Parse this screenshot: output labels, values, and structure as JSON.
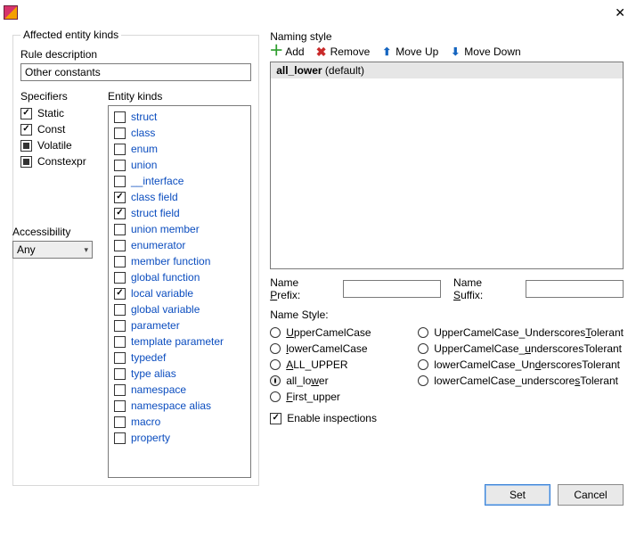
{
  "titlebar": {
    "close_aria": "Close"
  },
  "left": {
    "affected_legend": "Affected entity kinds",
    "rule_desc_label": "Rule description",
    "rule_desc_value": "Other constants",
    "specifiers_label": "Specifiers",
    "specifiers": [
      {
        "label": "Static",
        "state": "checked"
      },
      {
        "label": "Const",
        "state": "checked"
      },
      {
        "label": "Volatile",
        "state": "filled"
      },
      {
        "label": "Constexpr",
        "state": "filled"
      }
    ],
    "entity_label": "Entity kinds",
    "entities": [
      {
        "label": "struct",
        "checked": false
      },
      {
        "label": "class",
        "checked": false
      },
      {
        "label": "enum",
        "checked": false
      },
      {
        "label": "union",
        "checked": false
      },
      {
        "label": "__interface",
        "checked": false
      },
      {
        "label": "class field",
        "checked": true
      },
      {
        "label": "struct field",
        "checked": true
      },
      {
        "label": "union member",
        "checked": false
      },
      {
        "label": "enumerator",
        "checked": false
      },
      {
        "label": "member function",
        "checked": false
      },
      {
        "label": "global function",
        "checked": false
      },
      {
        "label": "local variable",
        "checked": true
      },
      {
        "label": "global variable",
        "checked": false
      },
      {
        "label": "parameter",
        "checked": false
      },
      {
        "label": "template parameter",
        "checked": false
      },
      {
        "label": "typedef",
        "checked": false
      },
      {
        "label": "type alias",
        "checked": false
      },
      {
        "label": "namespace",
        "checked": false
      },
      {
        "label": "namespace alias",
        "checked": false
      },
      {
        "label": "macro",
        "checked": false
      },
      {
        "label": "property",
        "checked": false
      }
    ],
    "accessibility_label": "Accessibility",
    "accessibility_value": "Any"
  },
  "right": {
    "naming_legend": "Naming style",
    "toolbar": {
      "add": "Add",
      "remove": "Remove",
      "moveup": "Move Up",
      "movedown": "Move Down"
    },
    "styles_list": [
      {
        "name": "all_lower",
        "suffix": " (default)"
      }
    ],
    "prefix_label_pre": "Name ",
    "prefix_label_u": "P",
    "prefix_label_post": "refix:",
    "suffix_label_pre": "Name ",
    "suffix_label_u": "S",
    "suffix_label_post": "uffix:",
    "prefix_value": "",
    "suffix_value": "",
    "name_style_label": "Name Style:",
    "styles": [
      {
        "id": "UpperCamelCase",
        "pre": "",
        "u": "U",
        "post": "pperCamelCase",
        "selected": false
      },
      {
        "id": "lowerCamelCase",
        "pre": "",
        "u": "l",
        "post": "owerCamelCase",
        "selected": false
      },
      {
        "id": "ALL_UPPER",
        "pre": "",
        "u": "A",
        "post": "LL_UPPER",
        "selected": false
      },
      {
        "id": "all_lower",
        "pre": "all_lo",
        "u": "w",
        "post": "er",
        "selected": true
      },
      {
        "id": "First_upper",
        "pre": "",
        "u": "F",
        "post": "irst_upper",
        "selected": false
      }
    ],
    "styles_right": [
      {
        "id": "UCUT",
        "pre": "UpperCamelCase_Underscores",
        "u": "T",
        "post": "olerant"
      },
      {
        "id": "UCut",
        "pre": "UpperCamelCase_",
        "u": "u",
        "post": "nderscoresTolerant"
      },
      {
        "id": "lCUT",
        "pre": "lowerCamelCase_Un",
        "u": "d",
        "post": "erscoresTolerant"
      },
      {
        "id": "lcut",
        "pre": "lowerCamelCase_underscore",
        "u": "s",
        "post": "Tolerant"
      }
    ],
    "enable_inspections": "Enable inspections",
    "enable_checked": true
  },
  "footer": {
    "set": "Set",
    "cancel": "Cancel"
  }
}
